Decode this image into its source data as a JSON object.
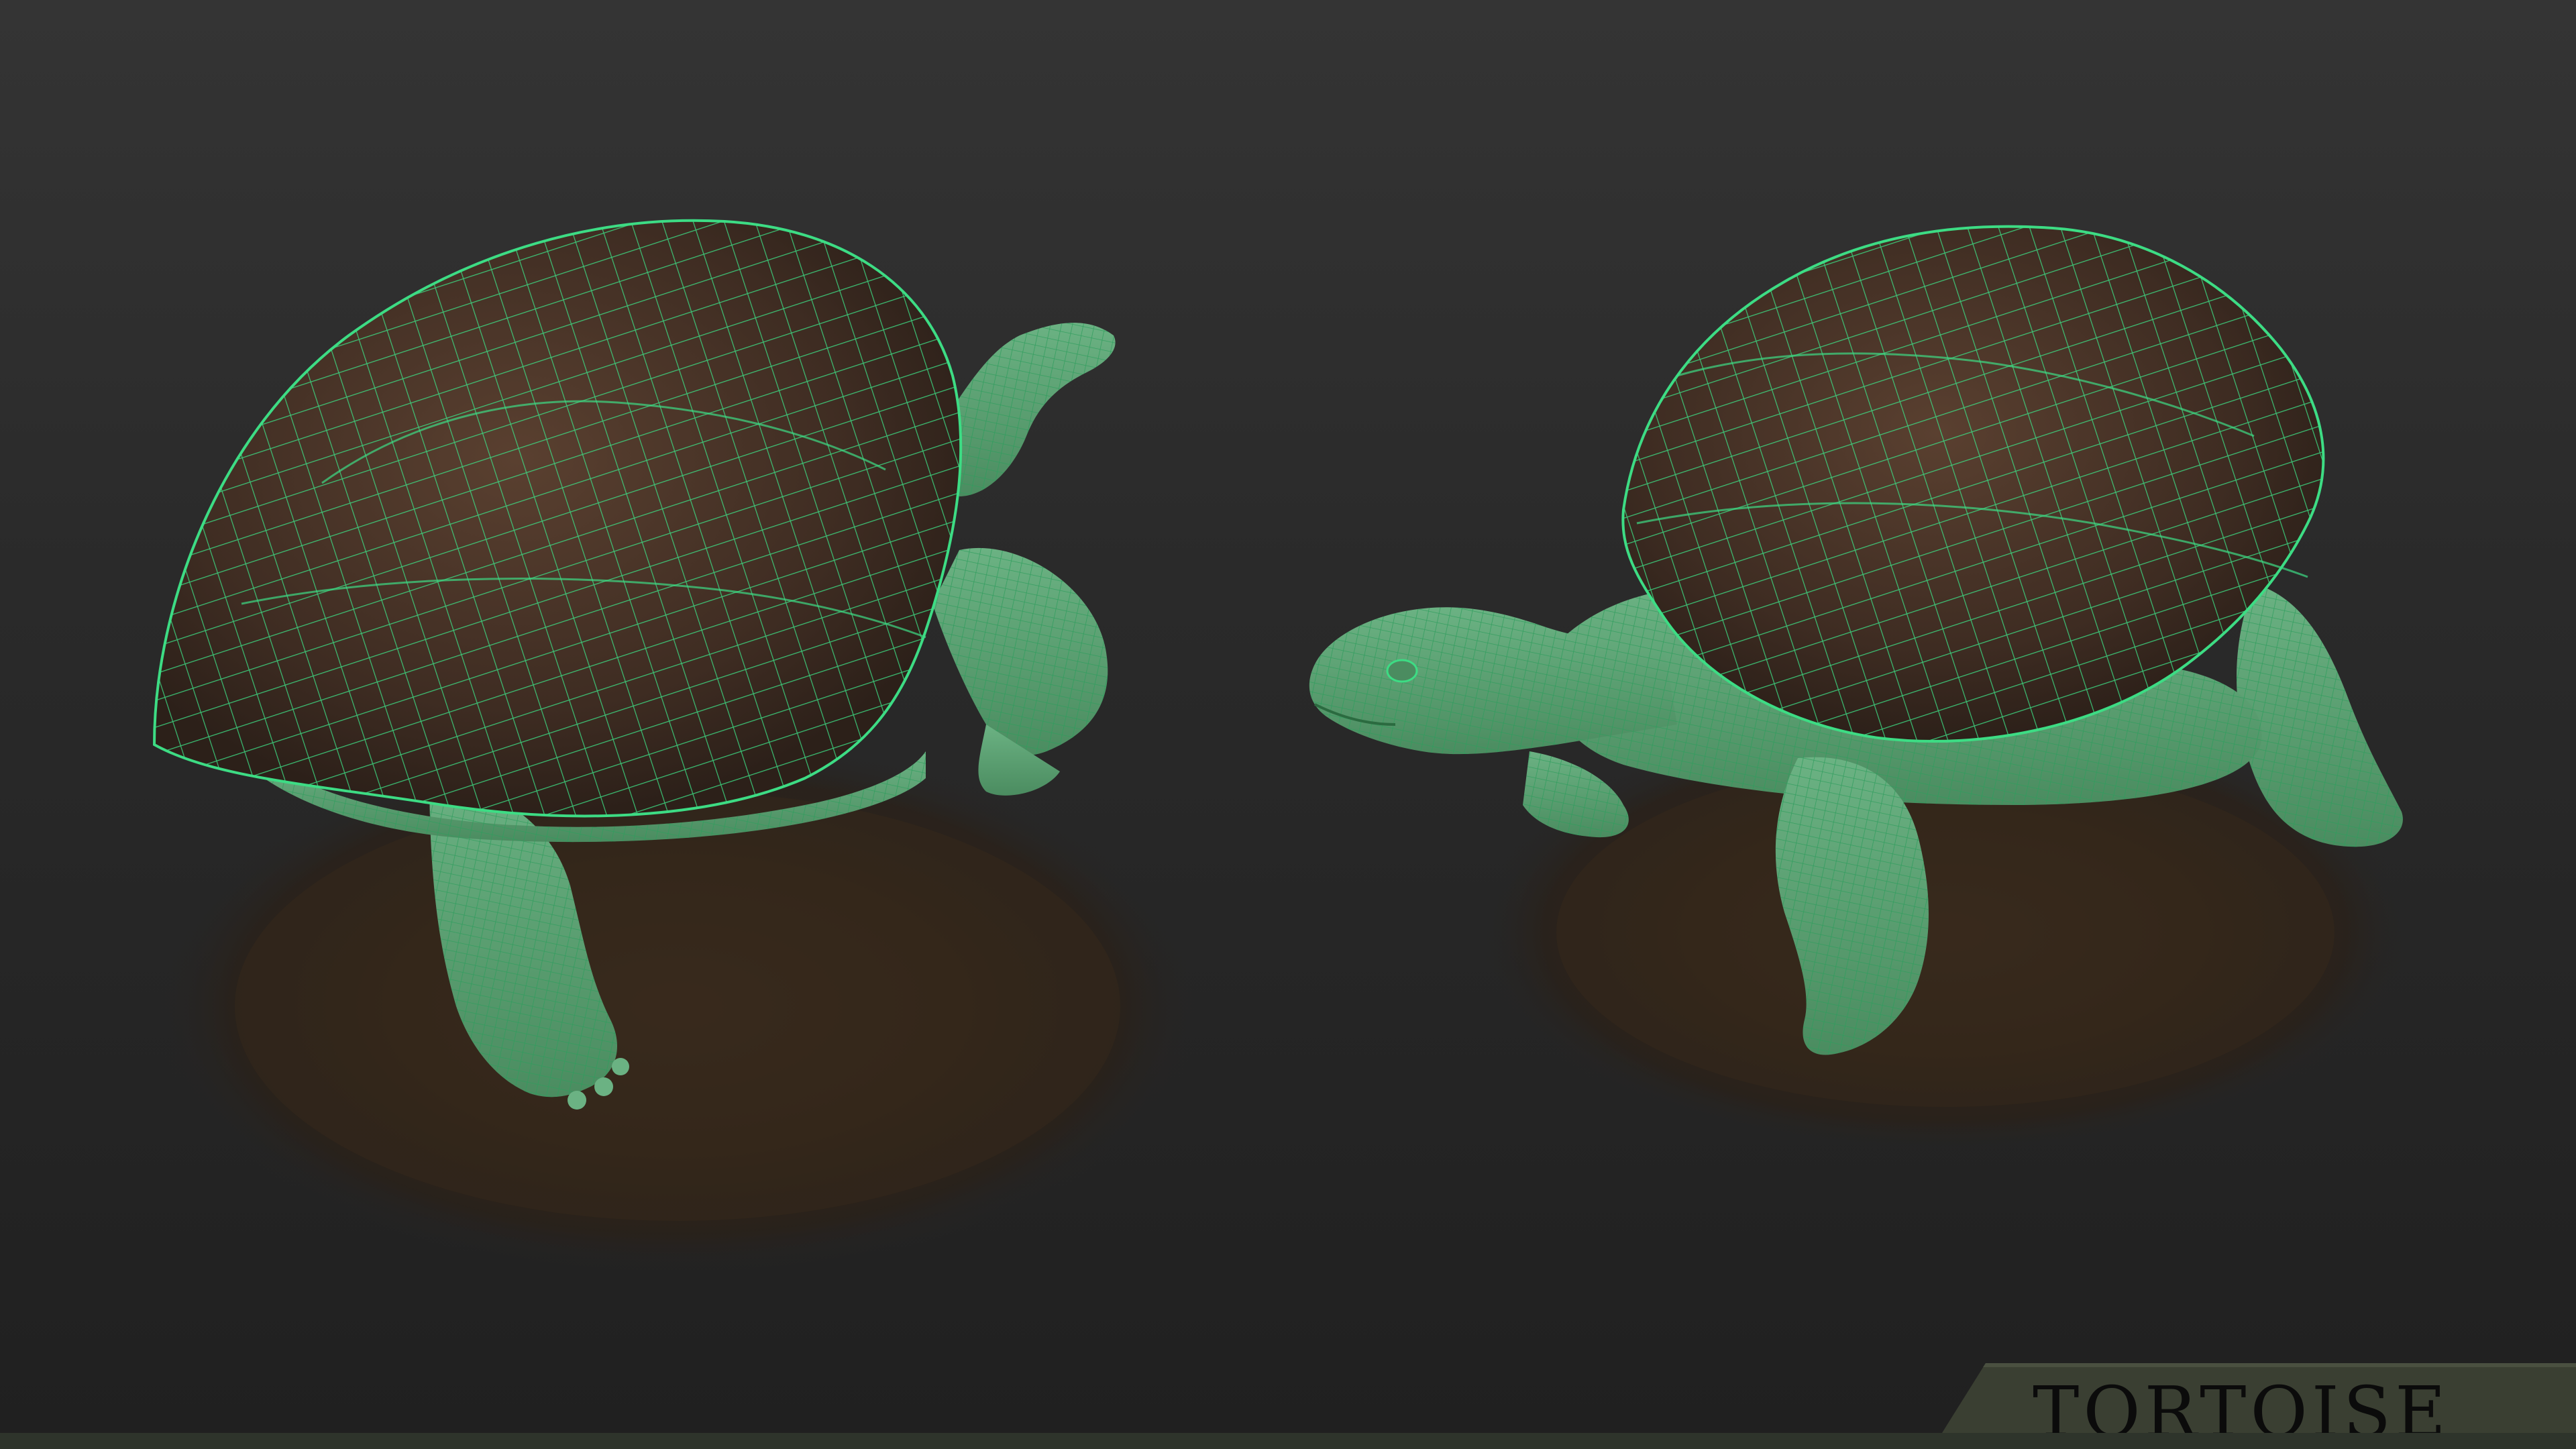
{
  "banner": {
    "title": "TORTOISE"
  },
  "colors": {
    "background": "#2a2a2a",
    "wireframe": "#3ddc84",
    "skin_fill": "#5fa374",
    "shell": "#4a3527",
    "ground": "#3a2a1c",
    "banner": "#3a3f32"
  },
  "scene": {
    "models": [
      {
        "id": "tortoise-rear-view"
      },
      {
        "id": "tortoise-front-view"
      }
    ]
  }
}
